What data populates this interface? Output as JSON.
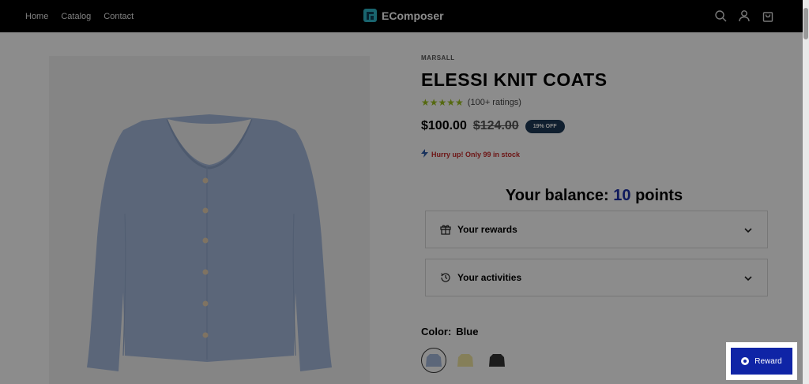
{
  "header": {
    "nav": [
      "Home",
      "Catalog",
      "Contact"
    ],
    "brand": "EComposer"
  },
  "product": {
    "vendor": "MARSALL",
    "title": "ELESSI KNIT COATS",
    "stars": "★★★★★",
    "rating_text": "(100+ ratings)",
    "price": "$100.00",
    "compare_price": "$124.00",
    "discount_badge": "19% OFF",
    "stock_text": "Hurry up! Only 99 in stock"
  },
  "rewards": {
    "balance_prefix": "Your balance:",
    "balance_value": "10",
    "balance_suffix": "points",
    "sections": [
      {
        "label": "Your rewards"
      },
      {
        "label": "Your activities"
      }
    ]
  },
  "color": {
    "label": "Color:",
    "selected": "Blue",
    "swatches": [
      "blue",
      "yellow",
      "black"
    ]
  },
  "reward_button": {
    "label": "Reward"
  },
  "colors": {
    "header_bg": "#000000",
    "accent_blue": "#0f24a6",
    "star_color": "#9bbf1d",
    "stock_red": "#c62828",
    "badge_bg": "#1e3a57"
  }
}
